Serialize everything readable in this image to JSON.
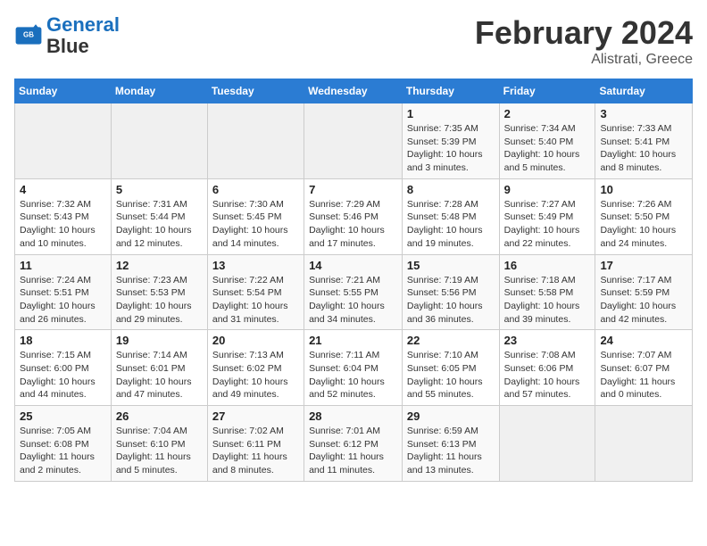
{
  "header": {
    "logo_line1": "General",
    "logo_line2": "Blue",
    "title": "February 2024",
    "subtitle": "Alistrati, Greece"
  },
  "calendar": {
    "days_of_week": [
      "Sunday",
      "Monday",
      "Tuesday",
      "Wednesday",
      "Thursday",
      "Friday",
      "Saturday"
    ],
    "weeks": [
      [
        {
          "num": "",
          "info": ""
        },
        {
          "num": "",
          "info": ""
        },
        {
          "num": "",
          "info": ""
        },
        {
          "num": "",
          "info": ""
        },
        {
          "num": "1",
          "info": "Sunrise: 7:35 AM\nSunset: 5:39 PM\nDaylight: 10 hours\nand 3 minutes."
        },
        {
          "num": "2",
          "info": "Sunrise: 7:34 AM\nSunset: 5:40 PM\nDaylight: 10 hours\nand 5 minutes."
        },
        {
          "num": "3",
          "info": "Sunrise: 7:33 AM\nSunset: 5:41 PM\nDaylight: 10 hours\nand 8 minutes."
        }
      ],
      [
        {
          "num": "4",
          "info": "Sunrise: 7:32 AM\nSunset: 5:43 PM\nDaylight: 10 hours\nand 10 minutes."
        },
        {
          "num": "5",
          "info": "Sunrise: 7:31 AM\nSunset: 5:44 PM\nDaylight: 10 hours\nand 12 minutes."
        },
        {
          "num": "6",
          "info": "Sunrise: 7:30 AM\nSunset: 5:45 PM\nDaylight: 10 hours\nand 14 minutes."
        },
        {
          "num": "7",
          "info": "Sunrise: 7:29 AM\nSunset: 5:46 PM\nDaylight: 10 hours\nand 17 minutes."
        },
        {
          "num": "8",
          "info": "Sunrise: 7:28 AM\nSunset: 5:48 PM\nDaylight: 10 hours\nand 19 minutes."
        },
        {
          "num": "9",
          "info": "Sunrise: 7:27 AM\nSunset: 5:49 PM\nDaylight: 10 hours\nand 22 minutes."
        },
        {
          "num": "10",
          "info": "Sunrise: 7:26 AM\nSunset: 5:50 PM\nDaylight: 10 hours\nand 24 minutes."
        }
      ],
      [
        {
          "num": "11",
          "info": "Sunrise: 7:24 AM\nSunset: 5:51 PM\nDaylight: 10 hours\nand 26 minutes."
        },
        {
          "num": "12",
          "info": "Sunrise: 7:23 AM\nSunset: 5:53 PM\nDaylight: 10 hours\nand 29 minutes."
        },
        {
          "num": "13",
          "info": "Sunrise: 7:22 AM\nSunset: 5:54 PM\nDaylight: 10 hours\nand 31 minutes."
        },
        {
          "num": "14",
          "info": "Sunrise: 7:21 AM\nSunset: 5:55 PM\nDaylight: 10 hours\nand 34 minutes."
        },
        {
          "num": "15",
          "info": "Sunrise: 7:19 AM\nSunset: 5:56 PM\nDaylight: 10 hours\nand 36 minutes."
        },
        {
          "num": "16",
          "info": "Sunrise: 7:18 AM\nSunset: 5:58 PM\nDaylight: 10 hours\nand 39 minutes."
        },
        {
          "num": "17",
          "info": "Sunrise: 7:17 AM\nSunset: 5:59 PM\nDaylight: 10 hours\nand 42 minutes."
        }
      ],
      [
        {
          "num": "18",
          "info": "Sunrise: 7:15 AM\nSunset: 6:00 PM\nDaylight: 10 hours\nand 44 minutes."
        },
        {
          "num": "19",
          "info": "Sunrise: 7:14 AM\nSunset: 6:01 PM\nDaylight: 10 hours\nand 47 minutes."
        },
        {
          "num": "20",
          "info": "Sunrise: 7:13 AM\nSunset: 6:02 PM\nDaylight: 10 hours\nand 49 minutes."
        },
        {
          "num": "21",
          "info": "Sunrise: 7:11 AM\nSunset: 6:04 PM\nDaylight: 10 hours\nand 52 minutes."
        },
        {
          "num": "22",
          "info": "Sunrise: 7:10 AM\nSunset: 6:05 PM\nDaylight: 10 hours\nand 55 minutes."
        },
        {
          "num": "23",
          "info": "Sunrise: 7:08 AM\nSunset: 6:06 PM\nDaylight: 10 hours\nand 57 minutes."
        },
        {
          "num": "24",
          "info": "Sunrise: 7:07 AM\nSunset: 6:07 PM\nDaylight: 11 hours\nand 0 minutes."
        }
      ],
      [
        {
          "num": "25",
          "info": "Sunrise: 7:05 AM\nSunset: 6:08 PM\nDaylight: 11 hours\nand 2 minutes."
        },
        {
          "num": "26",
          "info": "Sunrise: 7:04 AM\nSunset: 6:10 PM\nDaylight: 11 hours\nand 5 minutes."
        },
        {
          "num": "27",
          "info": "Sunrise: 7:02 AM\nSunset: 6:11 PM\nDaylight: 11 hours\nand 8 minutes."
        },
        {
          "num": "28",
          "info": "Sunrise: 7:01 AM\nSunset: 6:12 PM\nDaylight: 11 hours\nand 11 minutes."
        },
        {
          "num": "29",
          "info": "Sunrise: 6:59 AM\nSunset: 6:13 PM\nDaylight: 11 hours\nand 13 minutes."
        },
        {
          "num": "",
          "info": ""
        },
        {
          "num": "",
          "info": ""
        }
      ]
    ]
  }
}
